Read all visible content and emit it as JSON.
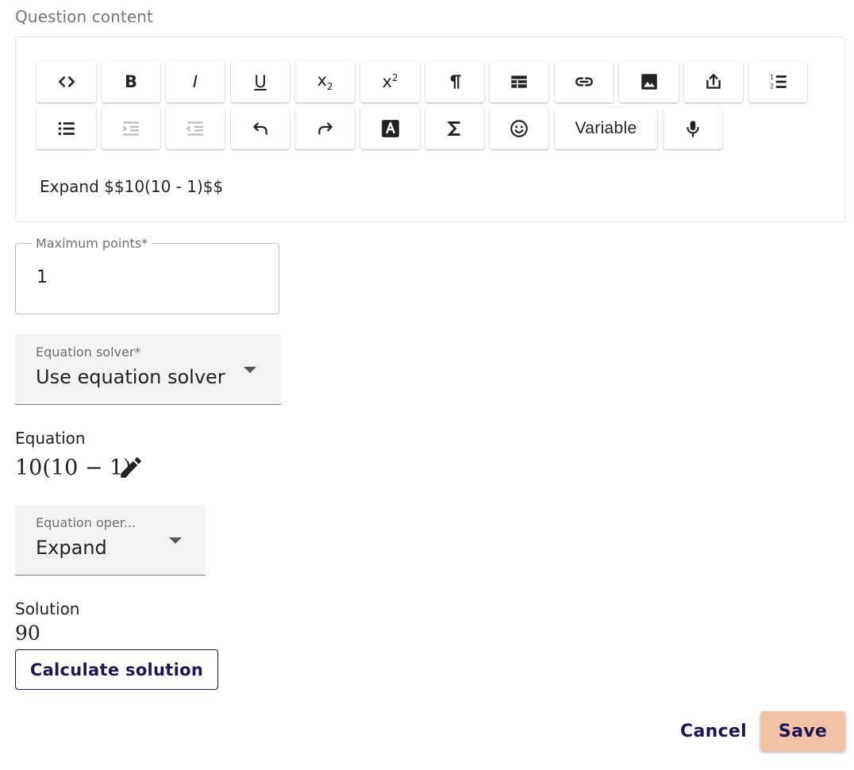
{
  "question_content": {
    "label": "Question content",
    "toolbar": {
      "code": "code-icon",
      "bold": "B",
      "italic": "I",
      "underline": "U",
      "subscript": "x",
      "subscript_index": "2",
      "superscript": "x",
      "superscript_index": "2",
      "variable": "Variable"
    },
    "text": "Expand $$10(10 - 1)$$"
  },
  "maximum_points": {
    "label": "Maximum points*",
    "value": "1"
  },
  "equation_solver": {
    "label": "Equation solver*",
    "value": "Use equation solver"
  },
  "equation": {
    "label": "Equation",
    "value": "10(10 − 1)"
  },
  "equation_operation": {
    "label": "Equation oper...",
    "value": "Expand"
  },
  "solution": {
    "label": "Solution",
    "value": "90"
  },
  "buttons": {
    "calculate": "Calculate solution",
    "cancel": "Cancel",
    "save": "Save"
  },
  "colors": {
    "primary": "#1e1652",
    "save_bg": "#f3c1a6",
    "disabled": "#b9b9b9"
  }
}
